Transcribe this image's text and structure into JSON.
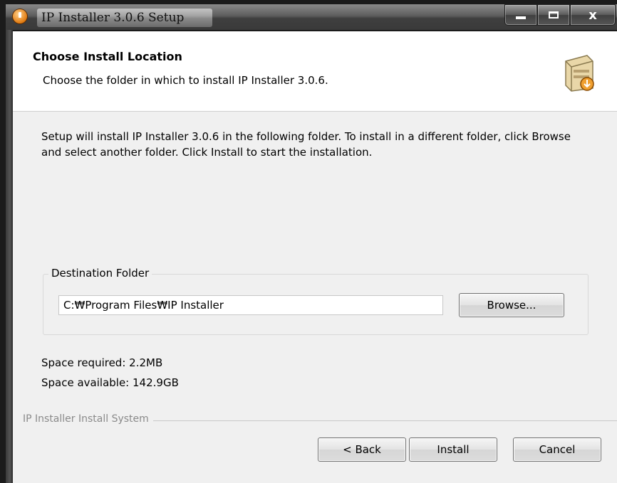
{
  "window": {
    "title": "IP Installer 3.0.6 Setup",
    "icon": "installer-app-icon",
    "controls": {
      "minimize": "minimize-icon",
      "maximize": "maximize-icon",
      "close": "x"
    }
  },
  "header": {
    "title": "Choose Install Location",
    "subtitle": "Choose the folder in which to install IP Installer 3.0.6.",
    "icon": "install-box-icon"
  },
  "main": {
    "description": "Setup will install IP Installer 3.0.6 in the following folder. To install in a different folder, click Browse and select another folder. Click Install to start the installation.",
    "destination": {
      "label": "Destination Folder",
      "path_value": "C:₩Program Files₩IP Installer",
      "browse_label": "Browse..."
    },
    "space_required": "Space required: 2.2MB",
    "space_available": "Space available: 142.9GB"
  },
  "footer": {
    "branding": "IP Installer Install System",
    "back_label": "< Back",
    "install_label": "Install",
    "cancel_label": "Cancel"
  }
}
